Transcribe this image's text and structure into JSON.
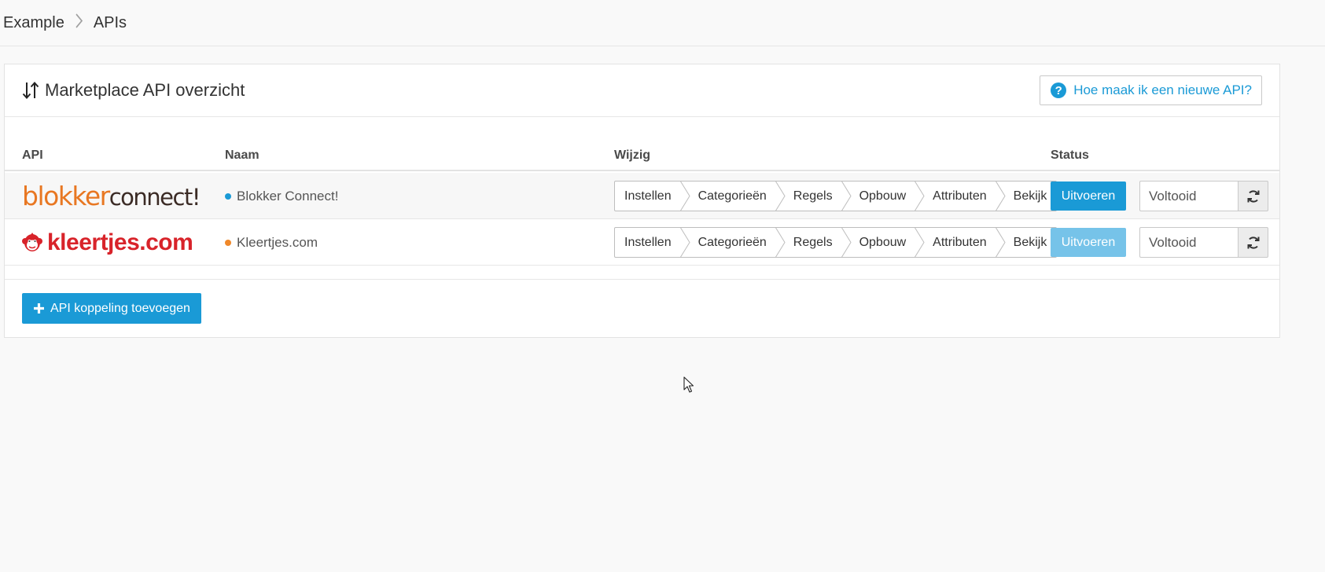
{
  "breadcrumb": {
    "items": [
      "Example",
      "APIs"
    ]
  },
  "panel": {
    "title": "Marketplace API overzicht",
    "help_label": "Hoe maak ik een nieuwe API?"
  },
  "table": {
    "columns": {
      "api": "API",
      "naam": "Naam",
      "wijzig": "Wijzig",
      "status": "Status"
    },
    "rows": [
      {
        "logo_part1": "blokker",
        "logo_part2": "connect!",
        "name": "Blokker Connect!",
        "dot_color": "#1a9ad6",
        "steps": [
          "Instellen",
          "Categorieën",
          "Regels",
          "Opbouw",
          "Attributen",
          "Bekijk"
        ],
        "run_label": "Uitvoeren",
        "status": "Voltooid"
      },
      {
        "logo_text": "kleertjes.com",
        "name": "Kleertjes.com",
        "dot_color": "#f0882a",
        "steps": [
          "Instellen",
          "Categorieën",
          "Regels",
          "Opbouw",
          "Attributen",
          "Bekijk"
        ],
        "run_label": "Uitvoeren",
        "status": "Voltooid"
      }
    ]
  },
  "add_button_label": "API koppeling toevoegen",
  "colors": {
    "accent": "#1a9ad6",
    "accent_disabled": "#76c3e9",
    "blokker_orange": "#e87722",
    "kleertjes_red": "#d8232a"
  },
  "icons": [
    "sort-arrows-icon",
    "question-circle-icon",
    "refresh-icon",
    "plus-icon",
    "chevron-right-icon",
    "mouse-cursor-icon",
    "monkey-logo-icon"
  ]
}
